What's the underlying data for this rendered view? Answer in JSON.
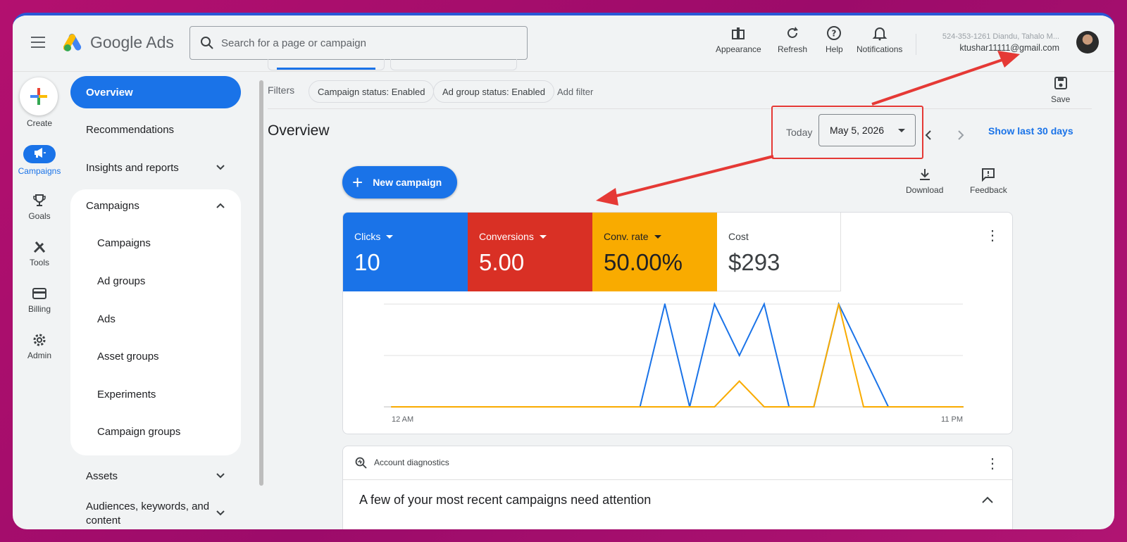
{
  "app": {
    "title": "Google Ads",
    "search_placeholder": "Search for a page or campaign"
  },
  "header_tools": [
    {
      "label": "Appearance",
      "icon": "appearance-icon"
    },
    {
      "label": "Refresh",
      "icon": "refresh-icon"
    },
    {
      "label": "Help",
      "icon": "help-icon"
    },
    {
      "label": "Notifications",
      "icon": "bell-icon"
    }
  ],
  "account": {
    "id_line": "524-353-1261 Diandu, Tahalo M...",
    "email": "ktushar11111@gmail.com"
  },
  "rail": {
    "create": "Create",
    "items": [
      {
        "label": "Campaigns",
        "icon": "megaphone-icon"
      },
      {
        "label": "Goals",
        "icon": "trophy-icon"
      },
      {
        "label": "Tools",
        "icon": "tools-icon"
      },
      {
        "label": "Billing",
        "icon": "credit-card-icon"
      },
      {
        "label": "Admin",
        "icon": "gear-icon"
      }
    ]
  },
  "sidenav": {
    "overview": "Overview",
    "recommendations": "Recommendations",
    "insights": "Insights and reports",
    "campaigns_section": "Campaigns",
    "sub_items": [
      "Campaigns",
      "Ad groups",
      "Ads",
      "Asset groups",
      "Experiments",
      "Campaign groups"
    ],
    "assets": "Assets",
    "audiences": "Audiences, keywords, and content"
  },
  "filters": {
    "label": "Filters",
    "chips": [
      "Campaign status: Enabled",
      "Ad group status: Enabled"
    ],
    "add": "Add filter",
    "save": "Save"
  },
  "overview": {
    "title": "Overview",
    "today": "Today",
    "date": "May 5, 2026",
    "show_last": "Show last 30 days",
    "new_campaign": "New campaign",
    "download": "Download",
    "feedback": "Feedback"
  },
  "metrics": [
    {
      "label": "Clicks",
      "value": "10",
      "color": "#1a73e8",
      "dropdown": true
    },
    {
      "label": "Conversions",
      "value": "5.00",
      "color": "#d93025",
      "dropdown": true
    },
    {
      "label": "Conv. rate",
      "value": "50.00%",
      "color": "#f9ab00",
      "dropdown": true
    },
    {
      "label": "Cost",
      "value": "$293",
      "color": "#ffffff",
      "dropdown": false
    }
  ],
  "chart_data": {
    "type": "line",
    "x_start_label": "12 AM",
    "x_end_label": "11 PM",
    "x": [
      0,
      1,
      2,
      3,
      4,
      5,
      6,
      7,
      8,
      9,
      10,
      11,
      12,
      13,
      14,
      15,
      16,
      17,
      18,
      19,
      20,
      21,
      22,
      23
    ],
    "series": [
      {
        "color": "#1a73e8",
        "values": [
          0,
          0,
          0,
          0,
          0,
          0,
          0,
          0,
          0,
          0,
          0,
          2,
          0,
          2,
          1,
          2,
          0,
          0,
          2,
          1,
          0,
          0,
          0,
          0
        ]
      },
      {
        "color": "#f9ab00",
        "values": [
          0,
          0,
          0,
          0,
          0,
          0,
          0,
          0,
          0,
          0,
          0,
          0,
          0,
          0,
          0.5,
          0,
          0,
          0,
          2,
          0,
          0,
          0,
          0,
          0
        ]
      }
    ],
    "ylim": [
      0,
      2
    ],
    "grid": true
  },
  "diagnostics": {
    "label": "Account diagnostics",
    "headline": "A few of your most recent campaigns need attention"
  },
  "colors": {
    "accent": "#1a73e8",
    "annotation": "#e53935"
  }
}
